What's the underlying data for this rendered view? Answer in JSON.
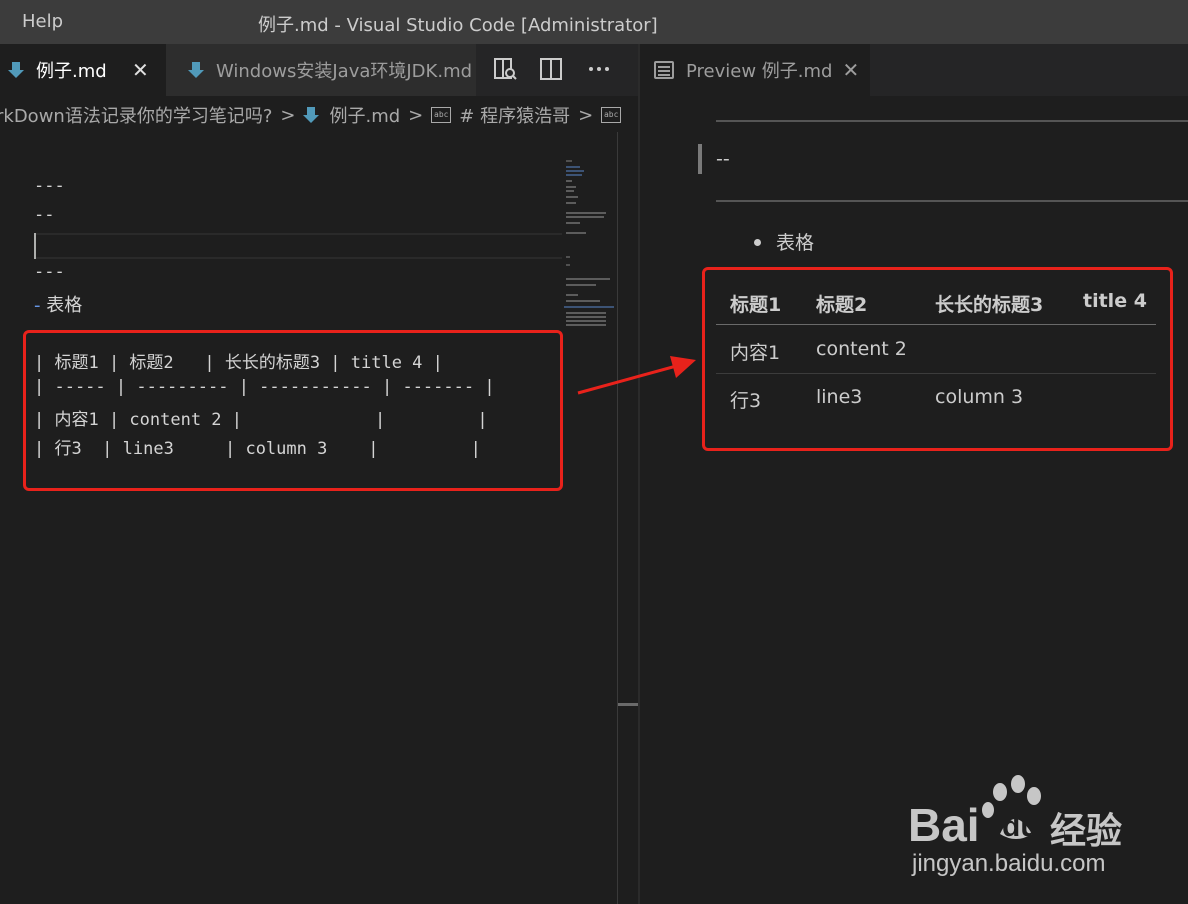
{
  "titlebar": {
    "menu_help": "Help",
    "window_title": "例子.md - Visual Studio Code [Administrator]"
  },
  "left_group": {
    "tabs": [
      {
        "label": "例子.md",
        "active": true
      },
      {
        "label": "Windows安装Java环境JDK.md",
        "active": false
      }
    ],
    "breadcrumb": {
      "folder": "rkDown语法记录你的学习笔记吗?",
      "file": "例子.md",
      "symbol": "# 程序猿浩哥",
      "abc": "abc"
    },
    "code_lines": [
      "---",
      "--",
      "",
      "---",
      "表格",
      "| 标题1 | 标题2   | 长长的标题3 | title 4 |",
      "| ----- | --------- | ----------- | ------- |",
      "| 内容1 | content 2 |             |         |",
      "| 行3  | line3     | column 3    |         |"
    ],
    "bullet_dash": "-"
  },
  "right_group": {
    "tab_label": "Preview 例子.md",
    "quote_text": "--",
    "bullet_text": "表格",
    "table": {
      "headers": [
        "标题1",
        "标题2",
        "长长的标题3",
        "title 4"
      ],
      "rows": [
        [
          "内容1",
          "content 2",
          "",
          ""
        ],
        [
          "行3",
          "line3",
          "column 3",
          ""
        ]
      ]
    }
  },
  "watermark": {
    "brand": "Bai",
    "brand_du": "du",
    "brand_cn": "经验",
    "url": "jingyan.baidu.com"
  },
  "colors": {
    "highlight": "#e8221b",
    "markdown_icon": "#519aba",
    "list_dash": "#6796e6"
  }
}
